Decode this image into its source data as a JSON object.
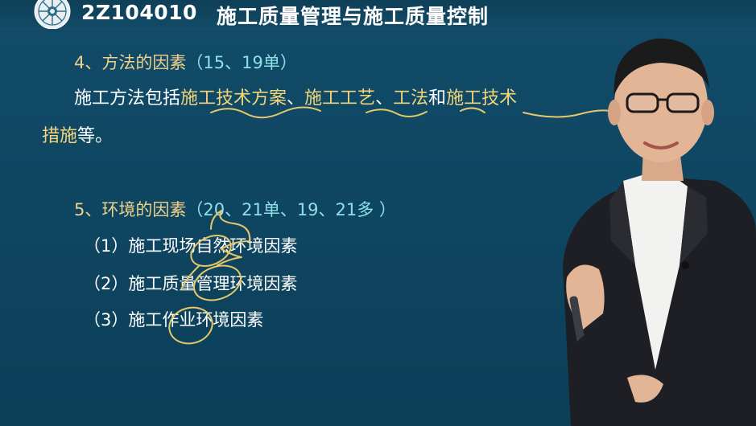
{
  "header": {
    "code": "2Z104010",
    "title": "施工质量管理与施工质量控制"
  },
  "section4": {
    "heading": "4、方法的因素",
    "tag": "（15、19单）",
    "body_prefix": "施工方法包括",
    "hl1": "施工技术方案",
    "sep1": "、",
    "hl2": "施工工艺",
    "sep2": "、",
    "hl3": "工法",
    "conj": "和",
    "hl4": "施工技术",
    "hl5": "措施",
    "suffix": "等。"
  },
  "section5": {
    "heading": "5、环境的因素",
    "tag": "（20、21单、19、21多 ）",
    "items": [
      "（1）施工现场自然环境因素",
      "（2）施工质量管理环境因素",
      "（3）施工作业环境因素"
    ]
  },
  "colors": {
    "background": "#0f4763",
    "heading": "#f0d08a",
    "tag": "#8fe0e6",
    "highlight": "#f4d57a",
    "ink": "#e6c86a"
  },
  "icons": {
    "logo": "sunburst-logo-icon"
  }
}
